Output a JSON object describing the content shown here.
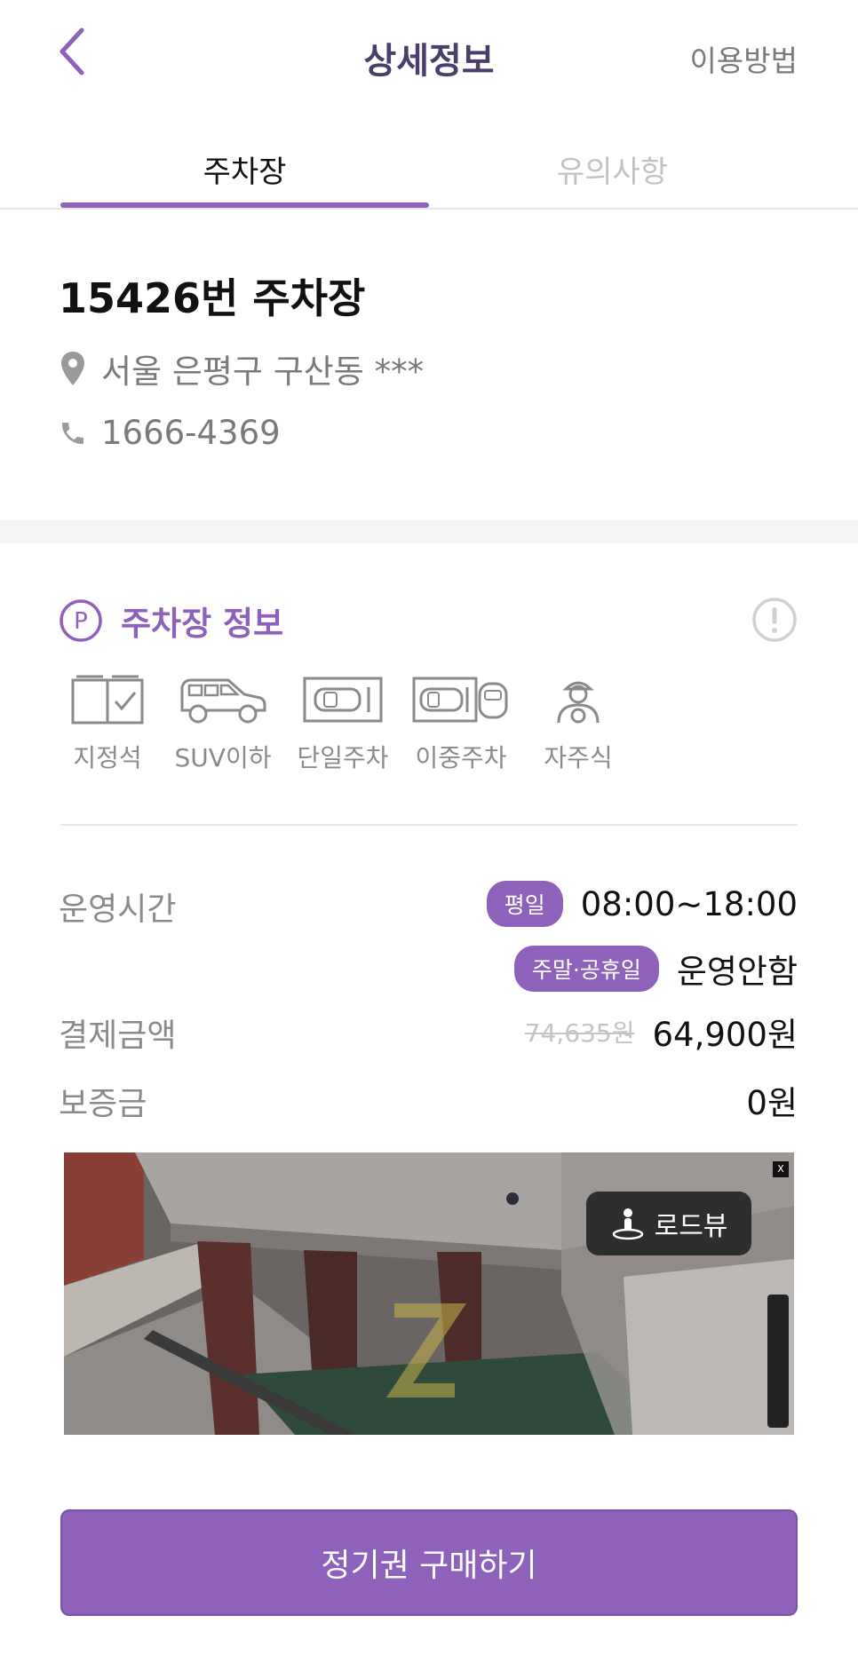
{
  "header": {
    "title": "상세정보",
    "guide_label": "이용방법"
  },
  "tabs": [
    {
      "label": "주차장",
      "active": true
    },
    {
      "label": "유의사항",
      "active": false
    }
  ],
  "lot": {
    "name": "15426번 주차장",
    "address": "서울 은평구 구산동 ***",
    "phone": "1666-4369"
  },
  "info": {
    "title": "주차장 정보",
    "features": [
      {
        "label": "지정석",
        "icon": "reserved-seat-icon"
      },
      {
        "label": "SUV이하",
        "icon": "suv-icon"
      },
      {
        "label": "단일주차",
        "icon": "single-parking-icon"
      },
      {
        "label": "이중주차",
        "icon": "double-parking-icon"
      },
      {
        "label": "자주식",
        "icon": "self-parking-icon"
      }
    ],
    "hours_label": "운영시간",
    "weekday_badge": "평일",
    "weekday_hours": "08:00~18:00",
    "weekend_badge": "주말·공휴일",
    "weekend_hours": "운영안함",
    "payment_label": "결제금액",
    "payment_original": "74,635원",
    "payment_price": "64,900원",
    "deposit_label": "보증금",
    "deposit_value": "0원"
  },
  "photo": {
    "roadview_label": "로드뷰",
    "close_label": "X"
  },
  "cta": {
    "label": "정기권 구매하기"
  },
  "colors": {
    "accent": "#8e62bb",
    "title_dark": "#4a3f6b",
    "muted_text": "#8a8a8a"
  }
}
